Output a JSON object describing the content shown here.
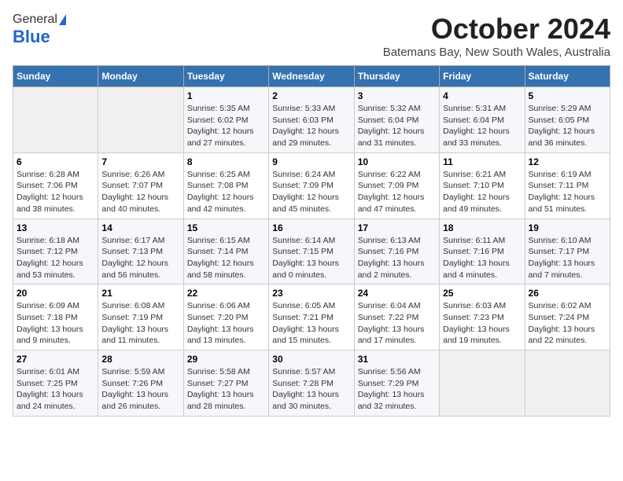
{
  "logo": {
    "general": "General",
    "blue": "Blue"
  },
  "title": "October 2024",
  "subtitle": "Batemans Bay, New South Wales, Australia",
  "headers": [
    "Sunday",
    "Monday",
    "Tuesday",
    "Wednesday",
    "Thursday",
    "Friday",
    "Saturday"
  ],
  "weeks": [
    [
      {
        "num": "",
        "detail": ""
      },
      {
        "num": "",
        "detail": ""
      },
      {
        "num": "1",
        "detail": "Sunrise: 5:35 AM\nSunset: 6:02 PM\nDaylight: 12 hours\nand 27 minutes."
      },
      {
        "num": "2",
        "detail": "Sunrise: 5:33 AM\nSunset: 6:03 PM\nDaylight: 12 hours\nand 29 minutes."
      },
      {
        "num": "3",
        "detail": "Sunrise: 5:32 AM\nSunset: 6:04 PM\nDaylight: 12 hours\nand 31 minutes."
      },
      {
        "num": "4",
        "detail": "Sunrise: 5:31 AM\nSunset: 6:04 PM\nDaylight: 12 hours\nand 33 minutes."
      },
      {
        "num": "5",
        "detail": "Sunrise: 5:29 AM\nSunset: 6:05 PM\nDaylight: 12 hours\nand 36 minutes."
      }
    ],
    [
      {
        "num": "6",
        "detail": "Sunrise: 6:28 AM\nSunset: 7:06 PM\nDaylight: 12 hours\nand 38 minutes."
      },
      {
        "num": "7",
        "detail": "Sunrise: 6:26 AM\nSunset: 7:07 PM\nDaylight: 12 hours\nand 40 minutes."
      },
      {
        "num": "8",
        "detail": "Sunrise: 6:25 AM\nSunset: 7:08 PM\nDaylight: 12 hours\nand 42 minutes."
      },
      {
        "num": "9",
        "detail": "Sunrise: 6:24 AM\nSunset: 7:09 PM\nDaylight: 12 hours\nand 45 minutes."
      },
      {
        "num": "10",
        "detail": "Sunrise: 6:22 AM\nSunset: 7:09 PM\nDaylight: 12 hours\nand 47 minutes."
      },
      {
        "num": "11",
        "detail": "Sunrise: 6:21 AM\nSunset: 7:10 PM\nDaylight: 12 hours\nand 49 minutes."
      },
      {
        "num": "12",
        "detail": "Sunrise: 6:19 AM\nSunset: 7:11 PM\nDaylight: 12 hours\nand 51 minutes."
      }
    ],
    [
      {
        "num": "13",
        "detail": "Sunrise: 6:18 AM\nSunset: 7:12 PM\nDaylight: 12 hours\nand 53 minutes."
      },
      {
        "num": "14",
        "detail": "Sunrise: 6:17 AM\nSunset: 7:13 PM\nDaylight: 12 hours\nand 56 minutes."
      },
      {
        "num": "15",
        "detail": "Sunrise: 6:15 AM\nSunset: 7:14 PM\nDaylight: 12 hours\nand 58 minutes."
      },
      {
        "num": "16",
        "detail": "Sunrise: 6:14 AM\nSunset: 7:15 PM\nDaylight: 13 hours\nand 0 minutes."
      },
      {
        "num": "17",
        "detail": "Sunrise: 6:13 AM\nSunset: 7:16 PM\nDaylight: 13 hours\nand 2 minutes."
      },
      {
        "num": "18",
        "detail": "Sunrise: 6:11 AM\nSunset: 7:16 PM\nDaylight: 13 hours\nand 4 minutes."
      },
      {
        "num": "19",
        "detail": "Sunrise: 6:10 AM\nSunset: 7:17 PM\nDaylight: 13 hours\nand 7 minutes."
      }
    ],
    [
      {
        "num": "20",
        "detail": "Sunrise: 6:09 AM\nSunset: 7:18 PM\nDaylight: 13 hours\nand 9 minutes."
      },
      {
        "num": "21",
        "detail": "Sunrise: 6:08 AM\nSunset: 7:19 PM\nDaylight: 13 hours\nand 11 minutes."
      },
      {
        "num": "22",
        "detail": "Sunrise: 6:06 AM\nSunset: 7:20 PM\nDaylight: 13 hours\nand 13 minutes."
      },
      {
        "num": "23",
        "detail": "Sunrise: 6:05 AM\nSunset: 7:21 PM\nDaylight: 13 hours\nand 15 minutes."
      },
      {
        "num": "24",
        "detail": "Sunrise: 6:04 AM\nSunset: 7:22 PM\nDaylight: 13 hours\nand 17 minutes."
      },
      {
        "num": "25",
        "detail": "Sunrise: 6:03 AM\nSunset: 7:23 PM\nDaylight: 13 hours\nand 19 minutes."
      },
      {
        "num": "26",
        "detail": "Sunrise: 6:02 AM\nSunset: 7:24 PM\nDaylight: 13 hours\nand 22 minutes."
      }
    ],
    [
      {
        "num": "27",
        "detail": "Sunrise: 6:01 AM\nSunset: 7:25 PM\nDaylight: 13 hours\nand 24 minutes."
      },
      {
        "num": "28",
        "detail": "Sunrise: 5:59 AM\nSunset: 7:26 PM\nDaylight: 13 hours\nand 26 minutes."
      },
      {
        "num": "29",
        "detail": "Sunrise: 5:58 AM\nSunset: 7:27 PM\nDaylight: 13 hours\nand 28 minutes."
      },
      {
        "num": "30",
        "detail": "Sunrise: 5:57 AM\nSunset: 7:28 PM\nDaylight: 13 hours\nand 30 minutes."
      },
      {
        "num": "31",
        "detail": "Sunrise: 5:56 AM\nSunset: 7:29 PM\nDaylight: 13 hours\nand 32 minutes."
      },
      {
        "num": "",
        "detail": ""
      },
      {
        "num": "",
        "detail": ""
      }
    ]
  ]
}
